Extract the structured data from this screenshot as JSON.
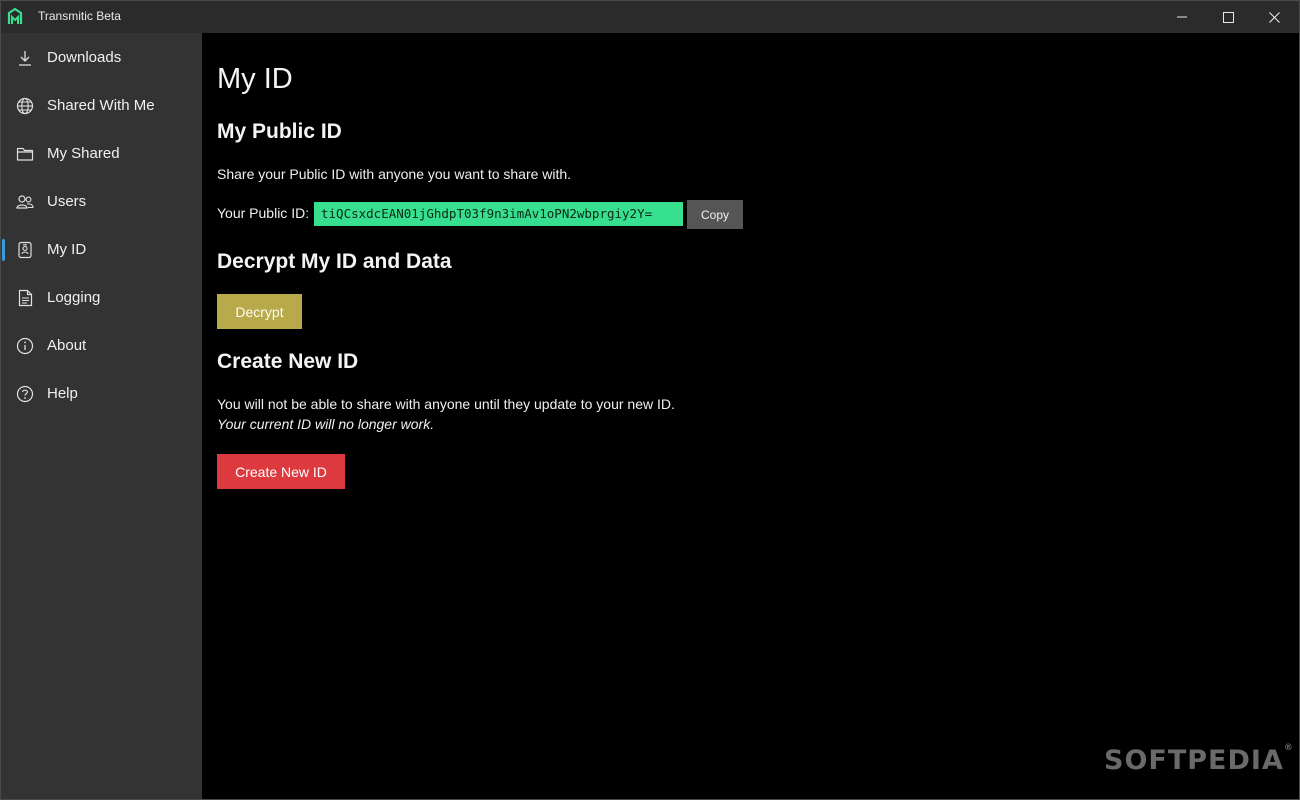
{
  "window": {
    "title": "Transmitic Beta"
  },
  "sidebar": {
    "items": [
      {
        "label": "Downloads",
        "icon": "download-icon"
      },
      {
        "label": "Shared With Me",
        "icon": "globe-icon"
      },
      {
        "label": "My Shared",
        "icon": "folder-icon"
      },
      {
        "label": "Users",
        "icon": "users-icon"
      },
      {
        "label": "My ID",
        "icon": "id-badge-icon",
        "active": true
      },
      {
        "label": "Logging",
        "icon": "document-icon"
      },
      {
        "label": "About",
        "icon": "info-icon"
      },
      {
        "label": "Help",
        "icon": "help-icon"
      }
    ]
  },
  "main": {
    "title": "My ID",
    "public_id": {
      "heading": "My Public ID",
      "description": "Share your Public ID with anyone you want to share with.",
      "label": "Your Public ID:",
      "value": "tiQCsxdcEAN01jGhdpT03f9n3imAv1oPN2wbprgiy2Y=",
      "copy_label": "Copy"
    },
    "decrypt": {
      "heading": "Decrypt My ID and Data",
      "button_label": "Decrypt"
    },
    "create": {
      "heading": "Create New ID",
      "warning": "You will not be able to share with anyone until they update to your new ID.",
      "warning_italic": "Your current ID will no longer work.",
      "button_label": "Create New ID"
    }
  },
  "watermark": {
    "text": "SOFTPEDIA",
    "mark": "®"
  },
  "colors": {
    "accent_indicator": "#3a9bdc",
    "public_id_bg": "#37e08f",
    "decrypt_button": "#b8a94a",
    "create_button": "#dc3a3f",
    "sidebar_bg": "#333333",
    "titlebar_bg": "#2b2b2b"
  }
}
